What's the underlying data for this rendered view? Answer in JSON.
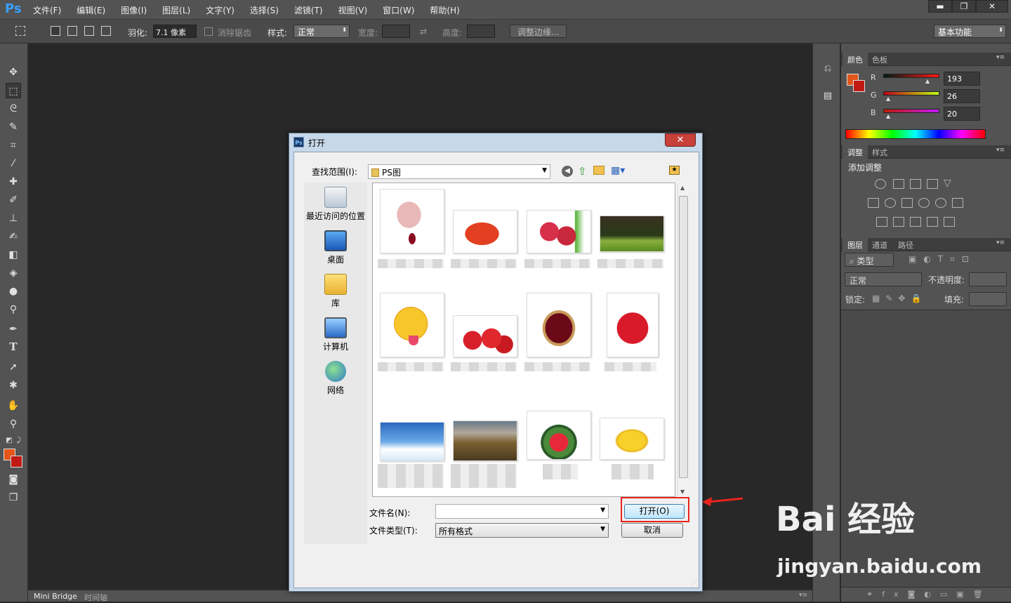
{
  "app": {
    "logo": "Ps",
    "menus": [
      "文件(F)",
      "编辑(E)",
      "图像(I)",
      "图层(L)",
      "文字(Y)",
      "选择(S)",
      "滤镜(T)",
      "视图(V)",
      "窗口(W)",
      "帮助(H)"
    ]
  },
  "window_controls": {
    "minimize": "▬",
    "restore": "❐",
    "close": "✕"
  },
  "options": {
    "feather_label": "羽化:",
    "feather_value": "7.1 像素",
    "antialias_label": "消除锯齿",
    "style_label": "样式:",
    "style_value": "正常",
    "width_label": "宽度:",
    "height_label": "高度:",
    "refine_button": "调整边缘...",
    "workspace": "基本功能"
  },
  "status": {
    "tabs": [
      "Mini Bridge",
      "时间轴"
    ]
  },
  "color_panel": {
    "tabs": [
      "颜色",
      "色板"
    ],
    "fg_color": "#e3561a",
    "bg_color": "#c11a14",
    "channels": [
      {
        "label": "R",
        "value": "193"
      },
      {
        "label": "G",
        "value": "26"
      },
      {
        "label": "B",
        "value": "20"
      }
    ]
  },
  "adjust_panel": {
    "tabs": [
      "调整",
      "样式"
    ],
    "title": "添加调整"
  },
  "layers_panel": {
    "tabs": [
      "图层",
      "通道",
      "路径"
    ],
    "filter": "类型",
    "blend": "正常",
    "opacity_label": "不透明度:",
    "lock_label": "锁定:",
    "fill_label": "填充:"
  },
  "dialog": {
    "title": "打开",
    "close": "✕",
    "lookin_label": "查找范围(I):",
    "lookin_value": "PS图",
    "places": [
      "最近访问的位置",
      "桌面",
      "库",
      "计算机",
      "网络"
    ],
    "filename_label": "文件名(N):",
    "filename_value": "",
    "filetype_label": "文件类型(T):",
    "filetype_value": "所有格式",
    "open_button": "打开(O)",
    "cancel_button": "取消"
  },
  "watermark": {
    "brand": "Bai 经验",
    "url": "jingyan.baidu.com"
  }
}
